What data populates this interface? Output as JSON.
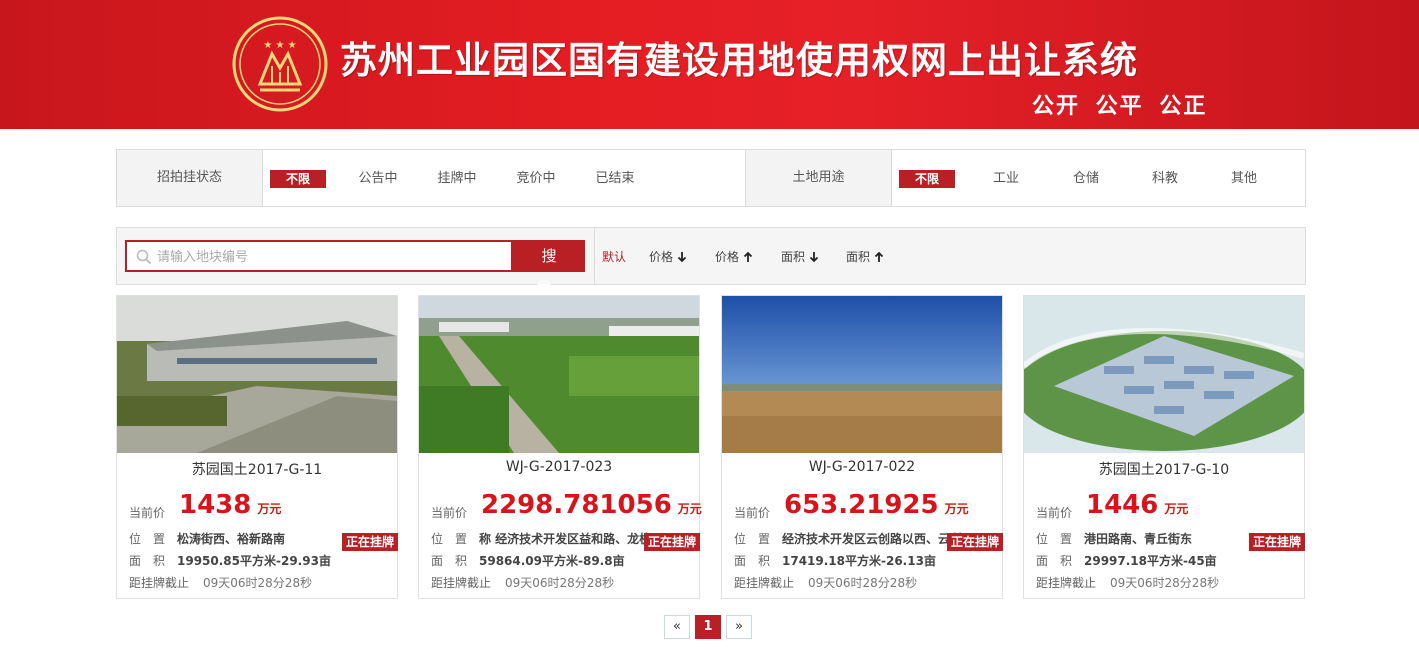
{
  "brand": {
    "title": "苏州工业园区国有建设用地使用权网上出让系统",
    "slogan": "公开 公平 公正",
    "accent": "#b82025"
  },
  "filters": {
    "status": {
      "label": "招拍挂状态",
      "options": [
        "不限",
        "公告中",
        "挂牌中",
        "竞价中",
        "已结束"
      ],
      "selected": "不限"
    },
    "usage": {
      "label": "土地用途",
      "options": [
        "不限",
        "工业",
        "仓储",
        "科教",
        "其他"
      ],
      "selected": "不限"
    }
  },
  "search": {
    "placeholder": "请输入地块编号",
    "button": "搜 索"
  },
  "sort": {
    "default": "默认",
    "price_desc": "价格",
    "price_asc": "价格",
    "area_desc": "面积",
    "area_asc": "面积"
  },
  "labels": {
    "price": "当前价",
    "unit": "万元",
    "location": "位　置",
    "area": "面　积",
    "deadline": "距挂牌截止",
    "status_tag": "正在挂牌"
  },
  "cards": [
    {
      "name": "苏园国土2017-G-11",
      "price": "1438",
      "location": "松涛街西、裕新路南",
      "area": "19950.85平方米-29.93亩",
      "countdown": "09天06时28分28秒"
    },
    {
      "name": "WJ-G-2017-023",
      "price": "2298.781056",
      "location": "称 经济技术开发区益和路、龙杭",
      "area": "59864.09平方米-89.8亩",
      "countdown": "09天06时28分28秒"
    },
    {
      "name": "WJ-G-2017-022",
      "price": "653.21925",
      "location": "经济技术开发区云创路以西、云梨",
      "area": "17419.18平方米-26.13亩",
      "countdown": "09天06时28分28秒"
    },
    {
      "name": "苏园国土2017-G-10",
      "price": "1446",
      "location": "港田路南、青丘街东",
      "area": "29997.18平方米-45亩",
      "countdown": "09天06时28分28秒"
    }
  ],
  "pagination": {
    "prev": "«",
    "current": "1",
    "next": "»"
  }
}
